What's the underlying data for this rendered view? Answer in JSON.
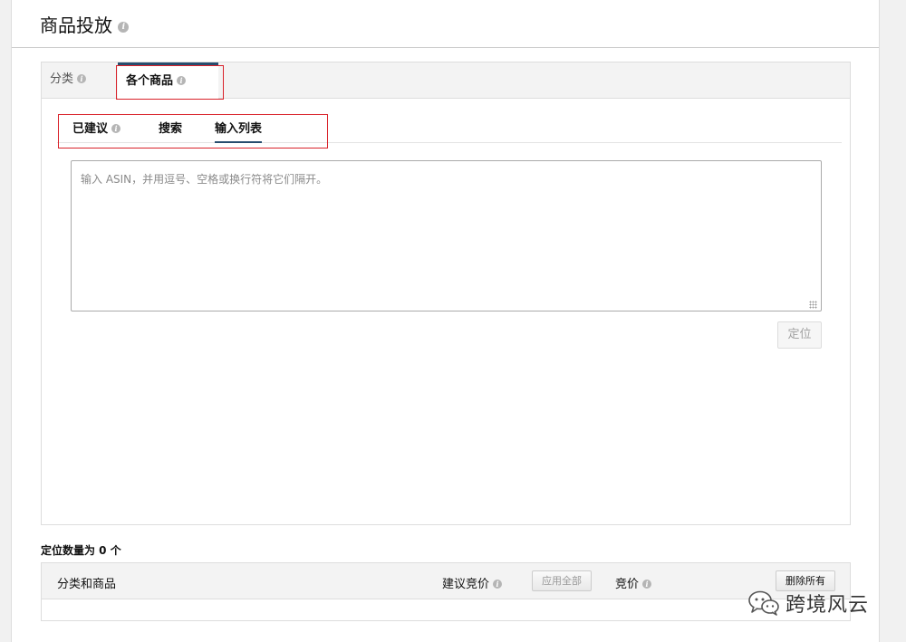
{
  "header": {
    "title": "商品投放"
  },
  "outer_tabs": [
    {
      "label": "分类",
      "active": false
    },
    {
      "label": "各个商品",
      "active": true
    }
  ],
  "inner_tabs": [
    {
      "label": "已建议",
      "active": false
    },
    {
      "label": "搜索",
      "active": false
    },
    {
      "label": "输入列表",
      "active": true
    }
  ],
  "asin_input": {
    "value": "",
    "placeholder": "输入 ASIN，并用逗号、空格或换行符将它们隔开。"
  },
  "target_button_label": "定位",
  "target_count_text": "定位数量为 0 个",
  "table": {
    "col_category_product": "分类和商品",
    "col_suggested_bid": "建议竞价",
    "apply_all_label": "应用全部",
    "col_bid": "竞价",
    "remove_all_label": "删除所有"
  },
  "watermark": {
    "text": "跨境风云",
    "icon": "wechat-icon"
  },
  "colors": {
    "active_tab_accent": "#264d6e",
    "highlight_border": "#d9222a"
  }
}
